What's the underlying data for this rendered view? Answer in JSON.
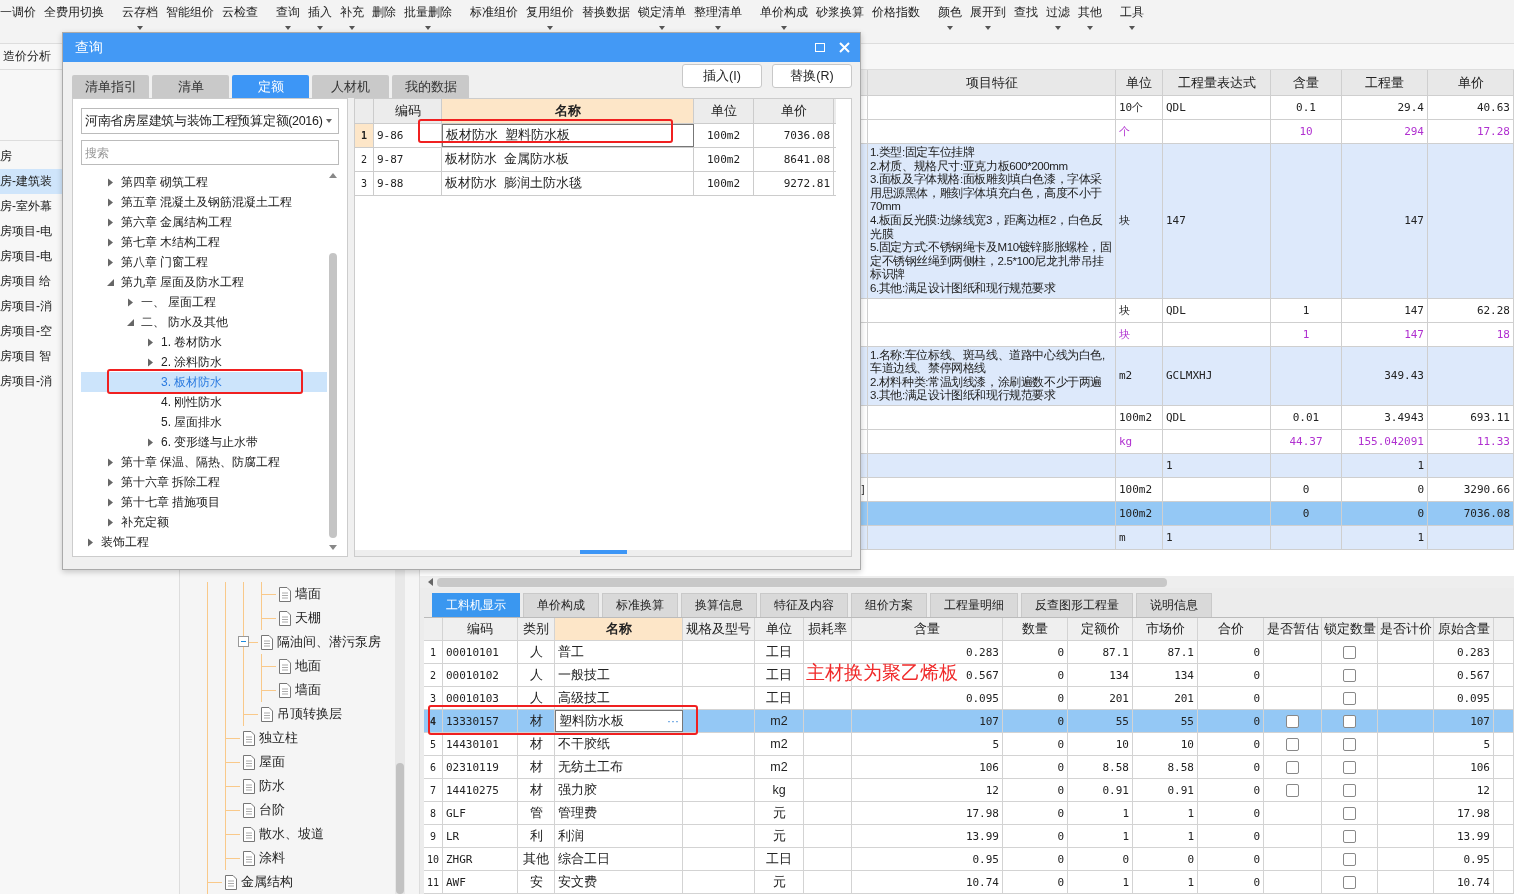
{
  "toolbar": [
    [
      {
        "label": "一调价",
        "dropdown": false
      },
      {
        "label": "全费用切换",
        "dropdown": false
      }
    ],
    [
      {
        "label": "云存档",
        "dropdown": true
      },
      {
        "label": "智能组价",
        "dropdown": false
      },
      {
        "label": "云检查",
        "dropdown": false
      }
    ],
    [
      {
        "label": "查询",
        "dropdown": true
      },
      {
        "label": "插入",
        "dropdown": true
      },
      {
        "label": "补充",
        "dropdown": true
      },
      {
        "label": "删除",
        "dropdown": false
      },
      {
        "label": "批量删除",
        "dropdown": true
      }
    ],
    [
      {
        "label": "标准组价",
        "dropdown": false
      },
      {
        "label": "复用组价",
        "dropdown": true
      },
      {
        "label": "替换数据",
        "dropdown": false
      },
      {
        "label": "锁定清单",
        "dropdown": true
      },
      {
        "label": "整理清单",
        "dropdown": true
      }
    ],
    [
      {
        "label": "单价构成",
        "dropdown": true
      },
      {
        "label": "砂浆换算",
        "dropdown": false
      },
      {
        "label": "价格指数",
        "dropdown": false
      }
    ],
    [
      {
        "label": "颜色",
        "dropdown": true
      },
      {
        "label": "展开到",
        "dropdown": true
      },
      {
        "label": "查找",
        "dropdown": false
      },
      {
        "label": "过滤",
        "dropdown": true
      },
      {
        "label": "其他",
        "dropdown": true
      }
    ],
    [
      {
        "label": "工具",
        "dropdown": true
      }
    ]
  ],
  "view_tab": "造价分析",
  "projects": [
    {
      "label": "房",
      "selected": false
    },
    {
      "label": "房-建筑装",
      "selected": true
    },
    {
      "label": "房-室外幕",
      "selected": false
    },
    {
      "label": "房项目-电",
      "selected": false
    },
    {
      "label": "房项目-电",
      "selected": false
    },
    {
      "label": "房项目 给",
      "selected": false
    },
    {
      "label": "房项目-消",
      "selected": false
    },
    {
      "label": "房项目-空",
      "selected": false
    },
    {
      "label": "房项目 智",
      "selected": false
    },
    {
      "label": "房项目-消",
      "selected": false
    }
  ],
  "part_tree": [
    {
      "children": [
        {
          "children": [
            {
              "children": [
                {
                  "label": "墙面"
                },
                {
                  "label": "天棚"
                }
              ]
            },
            {
              "expanded": true,
              "label": "隔油间、潜污泵房",
              "children": [
                {
                  "label": "地面"
                },
                {
                  "label": "墙面"
                }
              ]
            },
            {
              "label": "吊顶转换层"
            }
          ]
        },
        {
          "label": "独立柱"
        },
        {
          "label": "屋面"
        },
        {
          "label": "防水"
        },
        {
          "label": "台阶"
        },
        {
          "label": "散水、坡道"
        },
        {
          "label": "涂料"
        }
      ]
    },
    {
      "label": "金属结构"
    }
  ],
  "main_table": {
    "columns": [
      "项目特征",
      "单位",
      "工程量表达式",
      "含量",
      "工程量",
      "单价"
    ],
    "rows": [
      {
        "kind": "item",
        "selected": false,
        "unit": "10个",
        "expr": "QDL",
        "content": "0.1",
        "qty": "29.4",
        "price": "40.63"
      },
      {
        "kind": "material",
        "selected": false,
        "unit": "个",
        "content": "10",
        "qty": "294",
        "price": "17.28"
      },
      {
        "kind": "bill",
        "selected": false,
        "feature": "1.类型:固定车位挂牌\n2.材质、规格尺寸:亚克力板600*200mm\n3.面板及字体规格:面板雕刻填白色漆，字体采用思源黑体，雕刻字体填充白色，高度不小于70mm\n4.板面反光膜:边缘线宽3，距离边框2，白色反光膜\n5.固定方式:不锈钢绳卡及M10镀锌膨胀螺栓，固定不锈钢丝绳到两侧柱，2.5*100尼龙扎带吊挂标识牌\n6.其他:满足设计图纸和现行规范要求",
        "unit": "块",
        "expr": "147",
        "qty": "147"
      },
      {
        "kind": "item",
        "selected": false,
        "unit": "块",
        "expr": "QDL",
        "content": "1",
        "qty": "147",
        "price": "62.28"
      },
      {
        "kind": "material",
        "selected": false,
        "unit": "块",
        "content": "1",
        "qty": "147",
        "price": "18"
      },
      {
        "kind": "bill",
        "selected": false,
        "feature": "1.名称:车位标线、斑马线、道路中心线为白色,车道边线、禁停网格线\n2.材料种类:常温划线漆，涂刷遍数不少于两遍\n3.其他:满足设计图纸和现行规范要求",
        "unit": "m2",
        "expr": "GCLMXHJ",
        "qty": "349.43"
      },
      {
        "kind": "item",
        "selected": false,
        "unit": "100m2",
        "expr": "QDL",
        "content": "0.01",
        "qty": "3.4943",
        "price": "693.11"
      },
      {
        "kind": "material",
        "selected": false,
        "unit": "kg",
        "content": "44.37",
        "qty": "155.042091",
        "price": "11.33"
      },
      {
        "kind": "bill",
        "selected": false,
        "expr": "1",
        "qty": "1"
      },
      {
        "kind": "item",
        "selected": false,
        "lead": "]",
        "unit": "100m2",
        "content": "0",
        "qty": "0",
        "price": "3290.66"
      },
      {
        "kind": "item",
        "selected": true,
        "unit": "100m2",
        "content": "0",
        "qty": "0",
        "price": "7036.08"
      },
      {
        "kind": "bill",
        "selected": false,
        "unit": "m",
        "expr": "1",
        "qty": "1"
      }
    ]
  },
  "bottom_tabs": [
    {
      "label": "工料机显示",
      "selected": true
    },
    {
      "label": "单价构成",
      "selected": false
    },
    {
      "label": "标准换算",
      "selected": false
    },
    {
      "label": "换算信息",
      "selected": false
    },
    {
      "label": "特征及内容",
      "selected": false
    },
    {
      "label": "组价方案",
      "selected": false
    },
    {
      "label": "工程量明细",
      "selected": false
    },
    {
      "label": "反查图形工程量",
      "selected": false
    },
    {
      "label": "说明信息",
      "selected": false
    }
  ],
  "resource_table": {
    "columns": [
      "编码",
      "类别",
      "名称",
      "规格及型号",
      "单位",
      "损耗率",
      "含量",
      "数量",
      "定额价",
      "市场价",
      "合价",
      "是否暂估",
      "锁定数量",
      "是否计价",
      "原始含量"
    ],
    "rows": [
      {
        "index": "1",
        "code": "00010101",
        "type": "人",
        "name": "普工",
        "unit": "工日",
        "content": "0.283",
        "qty": "0",
        "base_price": "87.1",
        "market_price": "87.1",
        "total": "0",
        "lock": false,
        "original": "0.283",
        "selected": false
      },
      {
        "index": "2",
        "code": "00010102",
        "type": "人",
        "name": "一般技工",
        "unit": "工日",
        "content": "0.567",
        "qty": "0",
        "base_price": "134",
        "market_price": "134",
        "total": "0",
        "lock": false,
        "original": "0.567",
        "selected": false
      },
      {
        "index": "3",
        "code": "00010103",
        "type": "人",
        "name": "高级技工",
        "unit": "工日",
        "content": "0.095",
        "qty": "0",
        "base_price": "201",
        "market_price": "201",
        "total": "0",
        "lock": false,
        "original": "0.095",
        "selected": false
      },
      {
        "index": "4",
        "code": "13330157",
        "type": "材",
        "name": "塑料防水板",
        "name_button": "···",
        "unit": "m2",
        "content": "107",
        "qty": "0",
        "base_price": "55",
        "market_price": "55",
        "total": "0",
        "estimate": false,
        "lock": false,
        "original": "107",
        "selected": true
      },
      {
        "index": "5",
        "code": "14430101",
        "type": "材",
        "name": "不干胶纸",
        "unit": "m2",
        "content": "5",
        "qty": "0",
        "base_price": "10",
        "market_price": "10",
        "total": "0",
        "estimate": false,
        "lock": false,
        "original": "5",
        "selected": false
      },
      {
        "index": "6",
        "code": "02310119",
        "type": "材",
        "name": "无纺土工布",
        "unit": "m2",
        "content": "106",
        "qty": "0",
        "base_price": "8.58",
        "market_price": "8.58",
        "total": "0",
        "estimate": false,
        "lock": false,
        "original": "106",
        "selected": false
      },
      {
        "index": "7",
        "code": "14410275",
        "type": "材",
        "name": "强力胶",
        "unit": "kg",
        "content": "12",
        "qty": "0",
        "base_price": "0.91",
        "market_price": "0.91",
        "total": "0",
        "estimate": false,
        "lock": false,
        "original": "12",
        "selected": false
      },
      {
        "index": "8",
        "code": "GLF",
        "type": "管",
        "name": "管理费",
        "unit": "元",
        "content": "17.98",
        "qty": "0",
        "base_price": "1",
        "market_price": "1",
        "total": "0",
        "lock": false,
        "original": "17.98",
        "selected": false
      },
      {
        "index": "9",
        "code": "LR",
        "type": "利",
        "name": "利润",
        "unit": "元",
        "content": "13.99",
        "qty": "0",
        "base_price": "1",
        "market_price": "1",
        "total": "0",
        "lock": false,
        "original": "13.99",
        "selected": false
      },
      {
        "index": "10",
        "code": "ZHGR",
        "type": "其他",
        "name": "综合工日",
        "unit": "工日",
        "content": "0.95",
        "qty": "0",
        "base_price": "0",
        "market_price": "0",
        "total": "0",
        "lock": false,
        "original": "0.95",
        "selected": false
      },
      {
        "index": "11",
        "code": "AWF",
        "type": "安",
        "name": "安文费",
        "unit": "元",
        "content": "10.74",
        "qty": "0",
        "base_price": "1",
        "market_price": "1",
        "total": "0",
        "lock": false,
        "original": "10.74",
        "selected": false
      }
    ]
  },
  "dialog": {
    "title": "查询",
    "tabs": [
      {
        "label": "清单指引",
        "selected": false
      },
      {
        "label": "清单",
        "selected": false
      },
      {
        "label": "定额",
        "selected": true
      },
      {
        "label": "人材机",
        "selected": false
      },
      {
        "label": "我的数据",
        "selected": false
      }
    ],
    "buttons": [
      "插入(I)",
      "替换(R)"
    ],
    "library": "河南省房屋建筑与装饰工程预算定额(2016)",
    "search": {
      "placeholder": "搜索"
    },
    "tree": [
      {
        "children": [
          {
            "label": "第四章 砌筑工程",
            "kind": "branch",
            "expanded": false,
            "selected": false
          },
          {
            "label": "第五章 混凝土及钢筋混凝土工程",
            "kind": "branch",
            "expanded": false,
            "selected": false
          },
          {
            "label": "第六章 金属结构工程",
            "kind": "branch",
            "expanded": false,
            "selected": false
          },
          {
            "label": "第七章 木结构工程",
            "kind": "branch",
            "expanded": false,
            "selected": false
          },
          {
            "label": "第八章 门窗工程",
            "kind": "branch",
            "expanded": false,
            "selected": false
          },
          {
            "label": "第九章 屋面及防水工程",
            "kind": "branch",
            "expanded": true,
            "selected": false,
            "children": [
              {
                "label": "一、  屋面工程",
                "kind": "branch",
                "expanded": false,
                "selected": false
              },
              {
                "label": "二、  防水及其他",
                "kind": "branch",
                "expanded": true,
                "selected": false,
                "children": [
                  {
                    "label": "1. 卷材防水",
                    "kind": "branch",
                    "expanded": false,
                    "selected": false
                  },
                  {
                    "label": "2. 涂料防水",
                    "kind": "branch",
                    "expanded": false,
                    "selected": false
                  },
                  {
                    "label": "3. 板材防水",
                    "kind": "leaf",
                    "selected": true
                  },
                  {
                    "label": "4. 刚性防水",
                    "kind": "leaf",
                    "selected": false
                  },
                  {
                    "label": "5. 屋面排水",
                    "kind": "leaf",
                    "selected": false
                  },
                  {
                    "label": "6. 变形缝与止水带",
                    "kind": "branch",
                    "expanded": false,
                    "selected": false
                  }
                ]
              }
            ]
          },
          {
            "label": "第十章 保温、隔热、防腐工程",
            "kind": "branch",
            "expanded": false,
            "selected": false
          },
          {
            "label": "第十六章 拆除工程",
            "kind": "branch",
            "expanded": false,
            "selected": false
          },
          {
            "label": "第十七章 措施项目",
            "kind": "branch",
            "expanded": false,
            "selected": false
          },
          {
            "label": "补充定额",
            "kind": "branch",
            "expanded": false,
            "selected": false
          }
        ]
      },
      {
        "label": "装饰工程",
        "kind": "branch",
        "expanded": false,
        "selected": false
      }
    ],
    "table": {
      "columns": [
        "编码",
        "名称",
        "单位",
        "单价"
      ],
      "rows": [
        {
          "index": "1",
          "code": "9-86",
          "name": "板材防水  塑料防水板",
          "unit": "100m2",
          "price": "7036.08",
          "selected": true
        },
        {
          "index": "2",
          "code": "9-87",
          "name": "板材防水  金属防水板",
          "unit": "100m2",
          "price": "8641.08",
          "selected": false
        },
        {
          "index": "3",
          "code": "9-88",
          "name": "板材防水  膨润土防水毯",
          "unit": "100m2",
          "price": "9272.81",
          "selected": false
        }
      ]
    }
  },
  "note": "主材换为聚乙烯板"
}
